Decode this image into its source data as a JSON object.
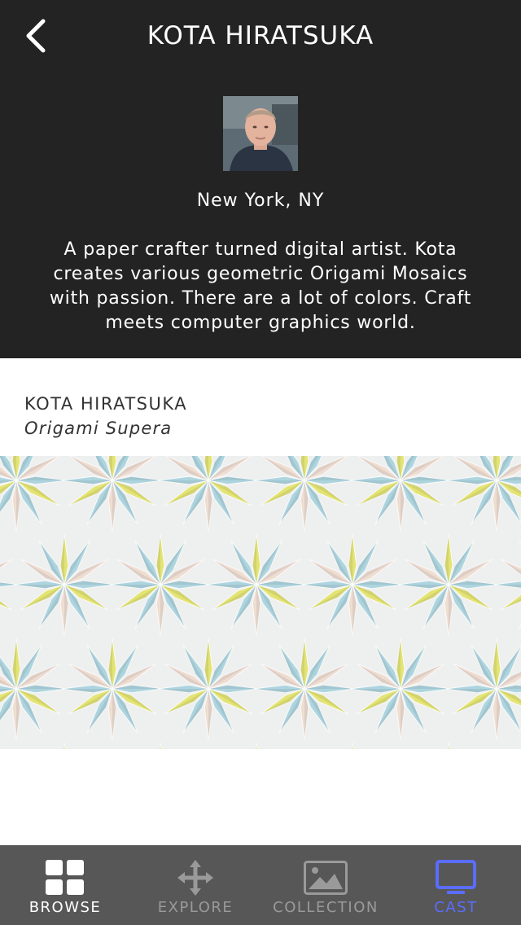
{
  "header": {
    "title": "KOTA HIRATSUKA",
    "back_icon": "chevron-left-icon",
    "location": "New York, NY",
    "bio": "A paper crafter turned digital artist.  Kota creates various geometric Origami Mosaics with passion. There are a lot of colors. Craft meets computer graphics world."
  },
  "artwork": {
    "artist": "KOTA HIRATSUKA",
    "title": "Origami Supera"
  },
  "tabbar": {
    "tabs": [
      {
        "label": "BROWSE",
        "icon": "grid-icon"
      },
      {
        "label": "EXPLORE",
        "icon": "move-arrows-icon"
      },
      {
        "label": "COLLECTION",
        "icon": "image-icon"
      },
      {
        "label": "CAST",
        "icon": "cast-screen-icon"
      }
    ],
    "active": "CAST"
  },
  "colors": {
    "header_bg": "#232323",
    "tabbar_bg": "#575757",
    "active_accent": "#5a6dff"
  }
}
